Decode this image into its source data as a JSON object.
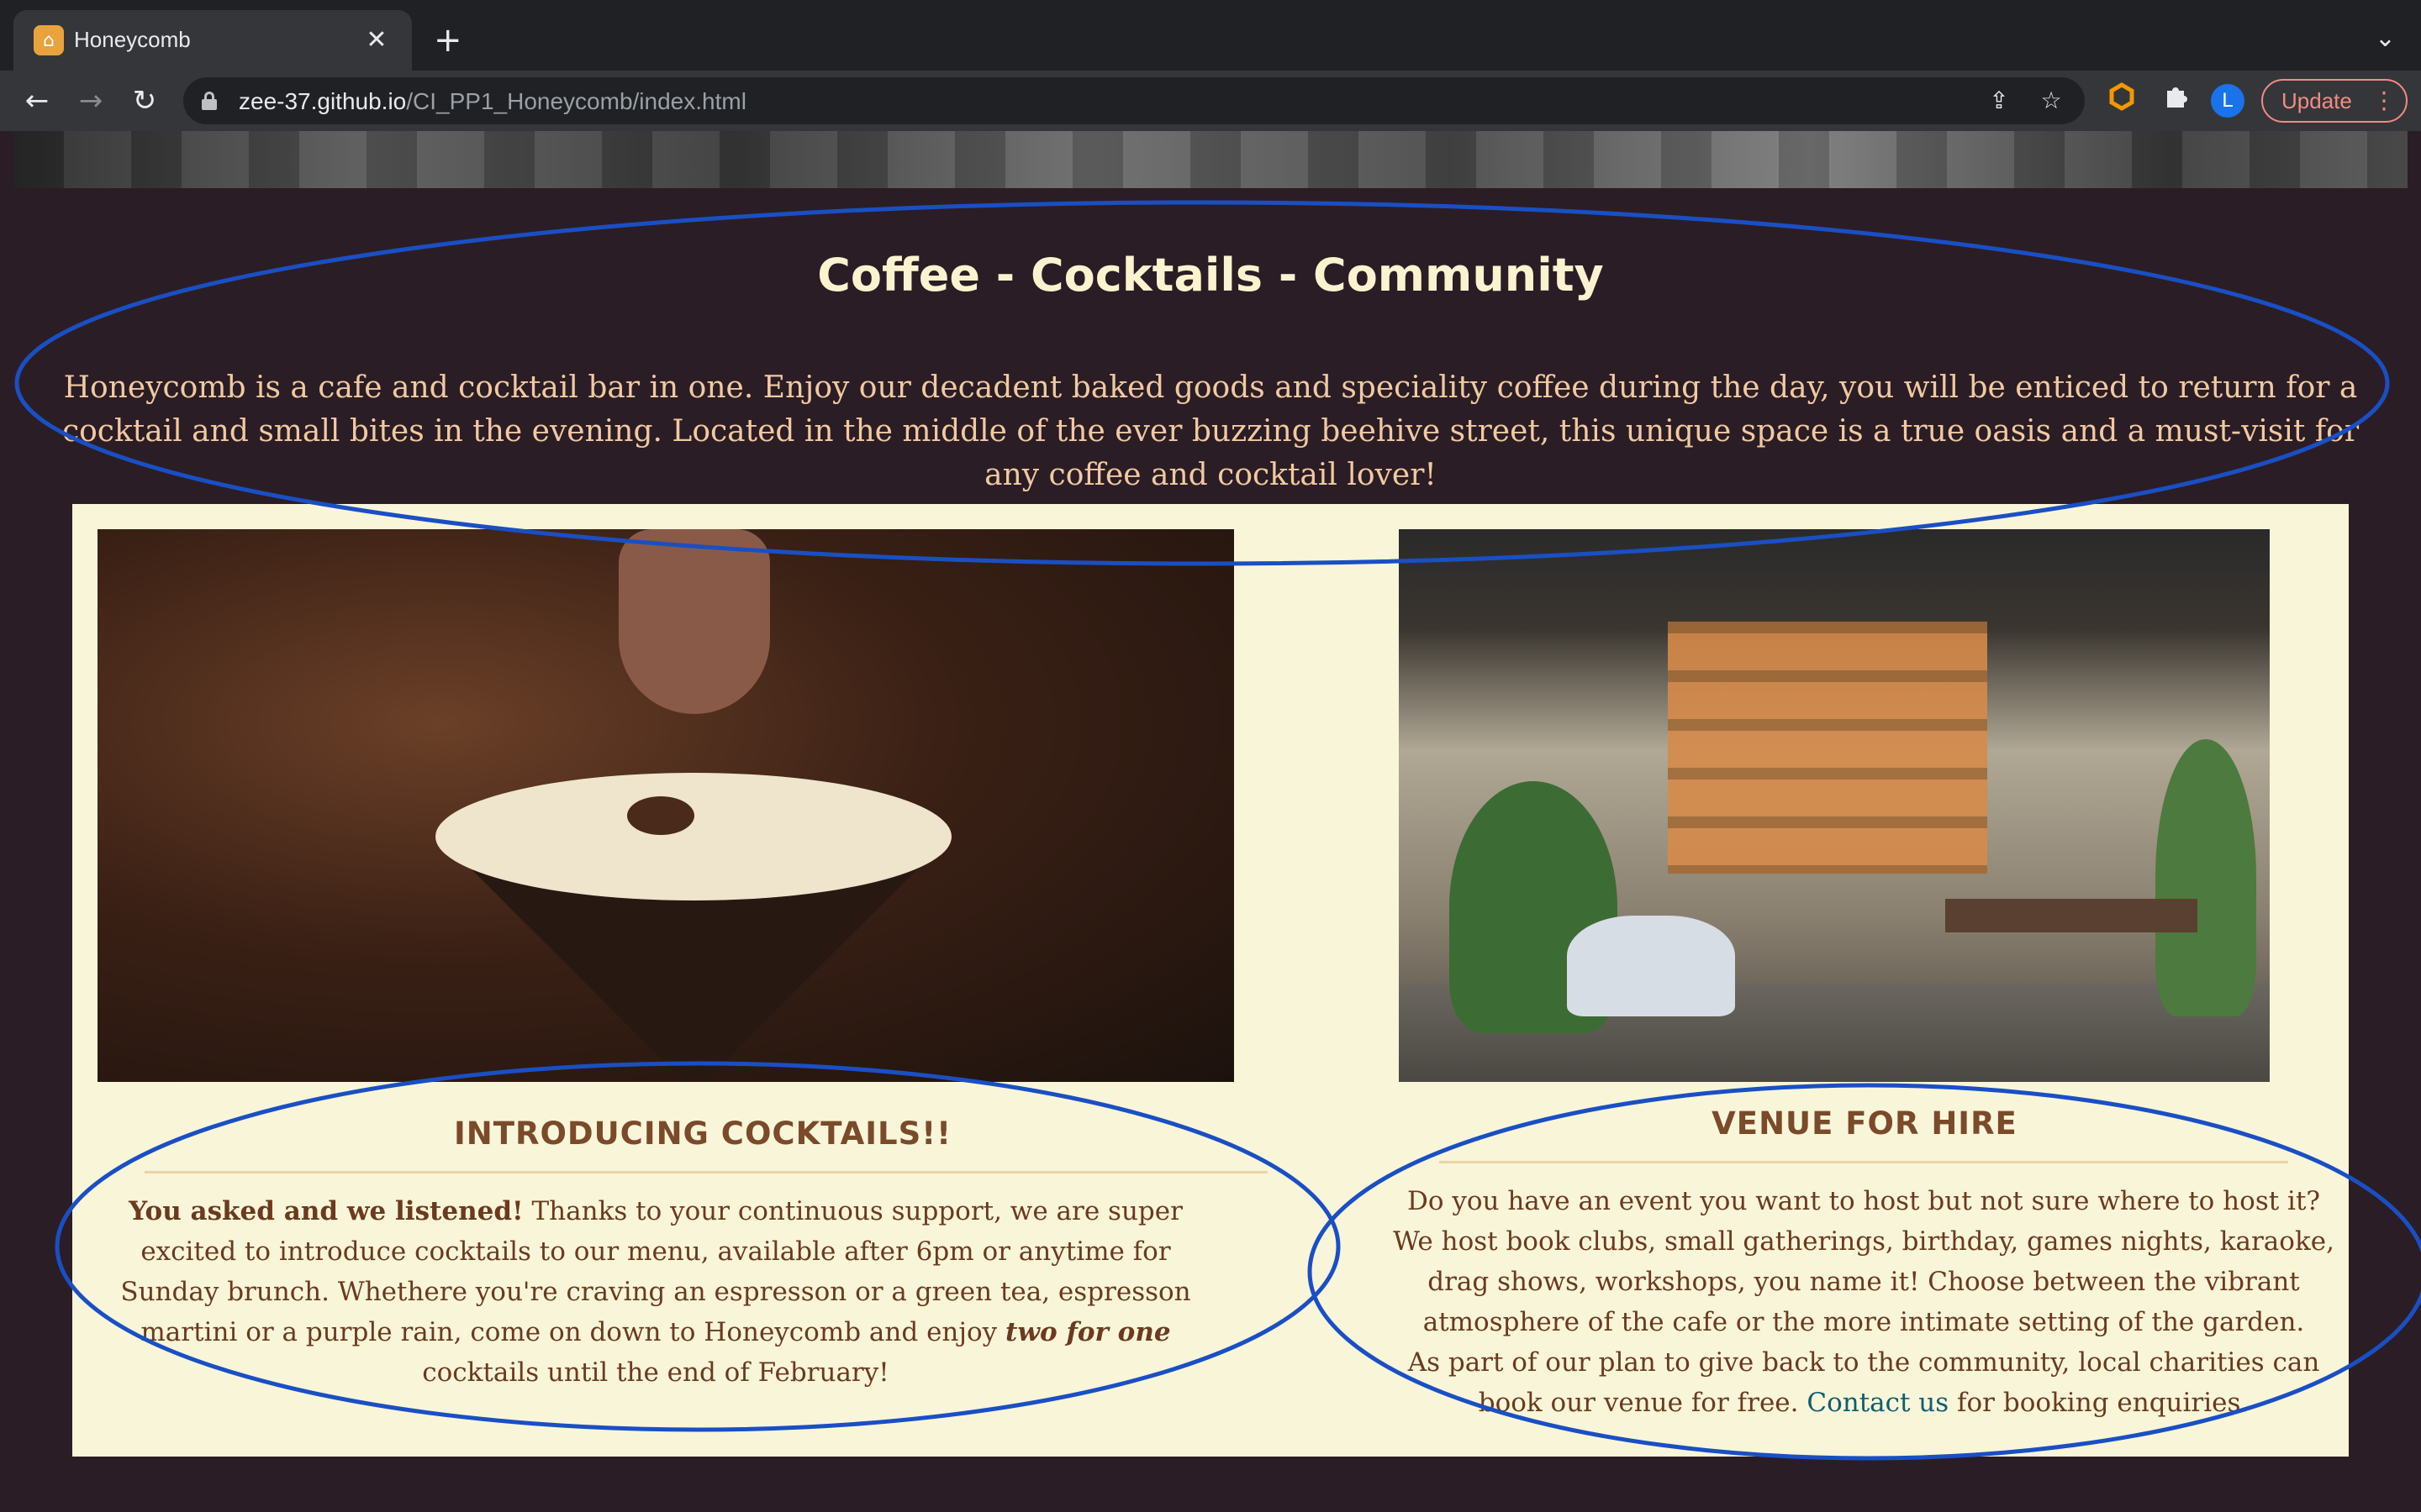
{
  "browser": {
    "tab_title": "Honeycomb",
    "tab_close": "✕",
    "new_tab": "+",
    "tab_menu": "⌄",
    "nav": {
      "back": "←",
      "forward": "→",
      "reload": "↻"
    },
    "url_host": "zee-37.github.io",
    "url_path": "/CI_PP1_Honeycomb/index.html",
    "share_icon": "⇪",
    "bookmark_icon": "☆",
    "profile_initial": "L",
    "update_label": "Update",
    "menu_dots": "⋮",
    "icons": [
      "lock-icon",
      "share-icon",
      "star-icon",
      "extension-g-icon",
      "puzzle-icon"
    ]
  },
  "page": {
    "headline": "Coffee - Cocktails - Community",
    "intro": "Honeycomb is a cafe and cocktail bar in one. Enjoy our decadent baked goods and speciality coffee during the day, you will be enticed to return for a cocktail and small bites in the evening. Located in the middle of the ever buzzing beehive street, this unique space is a true oasis and a must-visit for any coffee and cocktail lover!",
    "cocktails": {
      "title": "INTRODUCING COCKTAILS!!",
      "lead_bold": "You asked and we listened!",
      "text_1": " Thanks to your continuous support, we are super excited to introduce cocktails to our menu, available after 6pm or anytime for Sunday brunch. Whethere you're craving an espresson or a green tea, espresson martini or a purple rain, come on down to Honeycomb and enjoy ",
      "emphasis": "two for one",
      "text_2": " cocktails until the end of February!"
    },
    "venue": {
      "title": "VENUE FOR HIRE",
      "text_1": "Do you have an event you want to host but not sure where to host it? We host book clubs, small gatherings, birthday, games nights, karaoke, drag shows, workshops, you name it! Choose between the vibrant atmosphere of the cafe or the more intimate setting of the garden.",
      "text_2": "As part of our plan to give back to the community, local charities can book our venue for free. ",
      "link": "Contact us",
      "text_3": " for booking enquiries."
    }
  },
  "colors": {
    "page_bg": "#2b1d25",
    "panel_bg": "#f8f5d9",
    "headline": "#fbf3d0",
    "intro_text": "#f1c9a2",
    "card_title": "#7a4a2a",
    "card_text": "#6b3a1f",
    "link": "#0f5e70",
    "annotation": "#1a4fc4"
  }
}
